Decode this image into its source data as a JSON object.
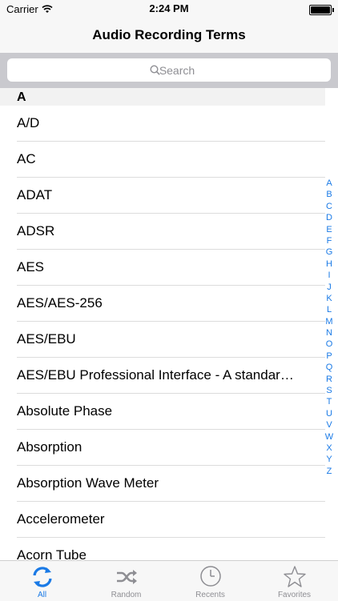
{
  "status": {
    "carrier": "Carrier",
    "time": "2:24 PM"
  },
  "nav": {
    "title": "Audio Recording Terms"
  },
  "search": {
    "placeholder": "Search"
  },
  "section": {
    "header": "A"
  },
  "rows": [
    {
      "label": "A/D"
    },
    {
      "label": "AC"
    },
    {
      "label": "ADAT"
    },
    {
      "label": "ADSR"
    },
    {
      "label": "AES"
    },
    {
      "label": "AES/AES-256"
    },
    {
      "label": "AES/EBU"
    },
    {
      "label": "AES/EBU Professional Interface - A standar…"
    },
    {
      "label": "Absolute Phase"
    },
    {
      "label": "Absorption"
    },
    {
      "label": "Absorption Wave Meter"
    },
    {
      "label": "Accelerometer"
    },
    {
      "label": "Acorn Tube"
    }
  ],
  "index": [
    "A",
    "B",
    "C",
    "D",
    "E",
    "F",
    "G",
    "H",
    "I",
    "J",
    "K",
    "L",
    "M",
    "N",
    "O",
    "P",
    "Q",
    "R",
    "S",
    "T",
    "U",
    "V",
    "W",
    "X",
    "Y",
    "Z"
  ],
  "tabs": [
    {
      "label": "All",
      "icon": "refresh-icon",
      "active": true
    },
    {
      "label": "Random",
      "icon": "shuffle-icon",
      "active": false
    },
    {
      "label": "Recents",
      "icon": "clock-icon",
      "active": false
    },
    {
      "label": "Favorites",
      "icon": "star-icon",
      "active": false
    }
  ],
  "colors": {
    "accent": "#1a7ae6",
    "inactive": "#8e8e93"
  }
}
